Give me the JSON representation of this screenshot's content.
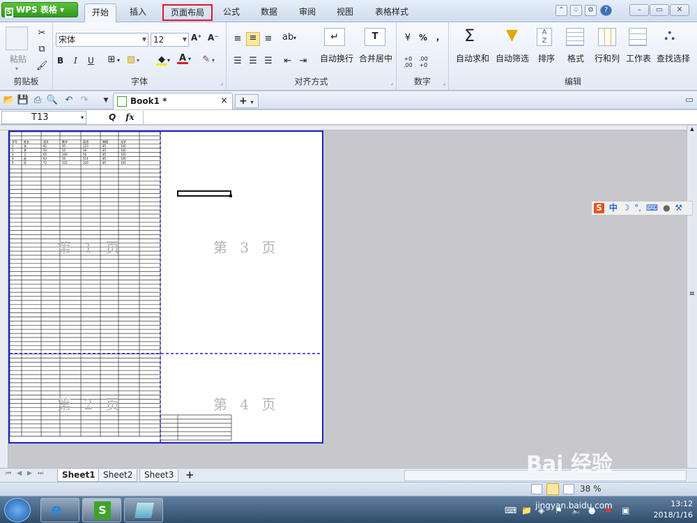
{
  "app": {
    "name": "WPS 表格",
    "logo_letter": "S"
  },
  "menu": {
    "tabs": [
      "开始",
      "插入",
      "页面布局",
      "公式",
      "数据",
      "审阅",
      "视图",
      "表格样式"
    ],
    "active_index": 0,
    "highlighted": "页面布局"
  },
  "ribbon": {
    "clipboard": {
      "label": "剪贴板",
      "paste": "粘贴"
    },
    "font": {
      "label": "字体",
      "name": "宋体",
      "size": "12",
      "grow": "A⁺",
      "shrink": "A⁻",
      "bold": "B",
      "italic": "I",
      "underline": "U",
      "color": "A"
    },
    "align": {
      "label": "对齐方式",
      "wrap": "自动换行",
      "merge": "合并居中"
    },
    "number": {
      "label": "数字",
      "percent": "%",
      "comma": "，"
    },
    "edit": {
      "label": "编辑",
      "autosum": "自动求和",
      "autofilter": "自动筛选",
      "sort": "排序",
      "format": "格式",
      "rowcol": "行和列",
      "worksheet": "工作表",
      "find": "查找选择"
    }
  },
  "doc": {
    "tab": "Book1 *",
    "close": "×",
    "new": "+"
  },
  "formula": {
    "namebox": "T13",
    "fx": "fx",
    "zoomicon": "Q"
  },
  "pages": [
    "第 1 页",
    "第 2 页",
    "第 3 页",
    "第 4 页"
  ],
  "table": {
    "headers": [
      "学号",
      "姓名",
      "语文",
      "数学",
      "英语",
      "物理",
      "化学"
    ],
    "rows": [
      [
        "1",
        "张",
        "82",
        "95",
        "123",
        "85",
        "100"
      ],
      [
        "2",
        "李",
        "50",
        "55",
        "56",
        "85",
        "100"
      ],
      [
        "3",
        "王",
        "65",
        "100",
        "56",
        "85",
        "100"
      ],
      [
        "4",
        "赵",
        "63",
        "50",
        "114",
        "85",
        "100"
      ],
      [
        "5",
        "孙",
        "72",
        "123",
        "120",
        "85",
        "100"
      ]
    ]
  },
  "ime": {
    "items": [
      "S",
      "中",
      "☽",
      "°,",
      "⌨",
      "👤",
      "🔧"
    ]
  },
  "sheets": [
    "Sheet1",
    "Sheet2",
    "Sheet3"
  ],
  "sheet_add": "+",
  "status": {
    "zoom": "38 %"
  },
  "taskbar": {
    "time": "13:12",
    "date": "2018/1/16"
  },
  "watermark": {
    "main": "Bai 经验",
    "url": "jingyan.baidu.com"
  }
}
